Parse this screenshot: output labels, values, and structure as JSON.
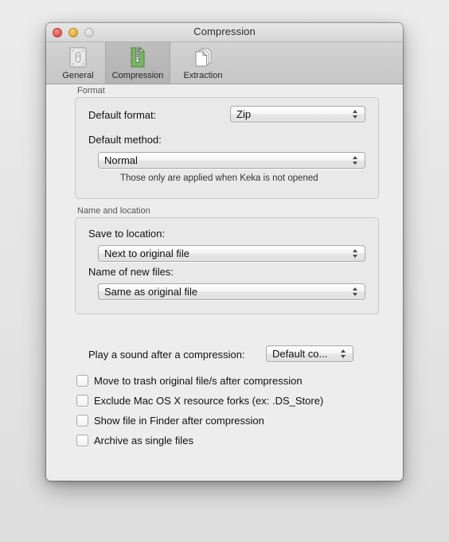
{
  "window": {
    "title": "Compression",
    "traffic_lights": [
      {
        "name": "close",
        "color": "#e8615a"
      },
      {
        "name": "minimize",
        "color": "#e5b43e"
      },
      {
        "name": "zoom",
        "color": "#d3d3d3"
      }
    ]
  },
  "toolbar": {
    "tabs": [
      {
        "label": "General",
        "icon": "switch-plate-icon",
        "selected": false
      },
      {
        "label": "Compression",
        "icon": "zip-document-icon",
        "selected": true
      },
      {
        "label": "Extraction",
        "icon": "stacked-documents-icon",
        "selected": false
      }
    ]
  },
  "format_group": {
    "title": "Format",
    "default_format_label": "Default format:",
    "default_format_value": "Zip",
    "default_method_label": "Default method:",
    "default_method_value": "Normal",
    "helper_text": "Those only are applied when Keka is not opened"
  },
  "name_location_group": {
    "title": "Name and location",
    "save_location_label": "Save to location:",
    "save_location_value": "Next to original file",
    "new_files_label": "Name of new files:",
    "new_files_value": "Same as original file"
  },
  "sound_row": {
    "label": "Play a sound after a compression:",
    "value": "Default co..."
  },
  "checkboxes": [
    {
      "label": "Move to trash original file/s after compression",
      "checked": false
    },
    {
      "label": "Exclude Mac OS X resource forks (ex: .DS_Store)",
      "checked": false
    },
    {
      "label": "Show file in Finder after compression",
      "checked": false
    },
    {
      "label": "Archive as single files",
      "checked": false
    }
  ]
}
